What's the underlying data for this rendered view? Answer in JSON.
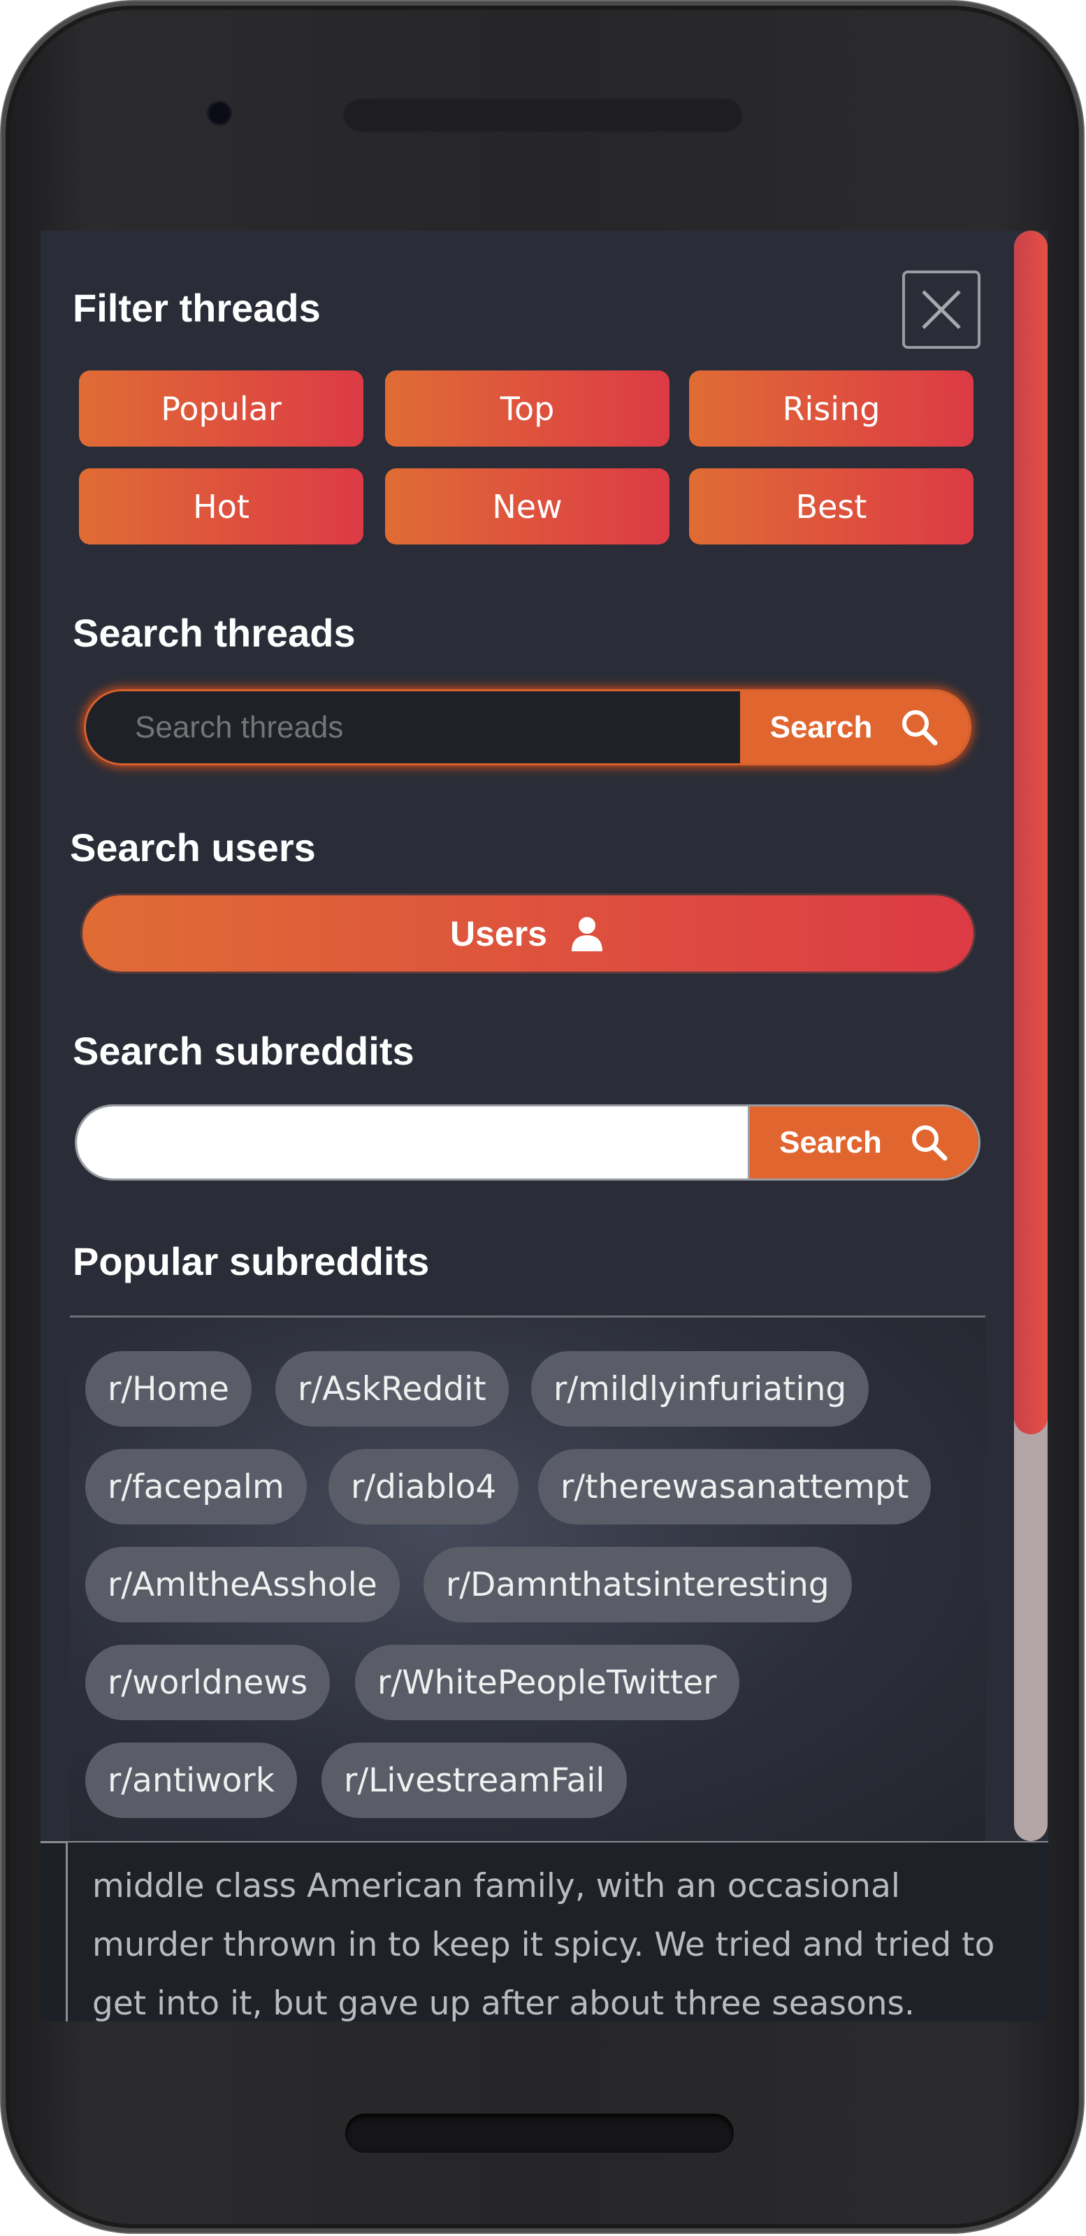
{
  "filter": {
    "title": "Filter threads",
    "buttons": [
      "Popular",
      "Top",
      "Rising",
      "Hot",
      "New",
      "Best"
    ]
  },
  "threads_search": {
    "title": "Search threads",
    "placeholder": "Search threads",
    "button_label": "Search"
  },
  "users_search": {
    "title": "Search users",
    "button_label": "Users"
  },
  "subreddit_search": {
    "title": "Search subreddits",
    "value": "",
    "button_label": "Search"
  },
  "popular": {
    "title": "Popular subreddits",
    "tags": [
      "r/Home",
      "r/AskReddit",
      "r/mildlyinfuriating",
      "r/facepalm",
      "r/diablo4",
      "r/therewasanattempt",
      "r/AmItheAsshole",
      "r/Damnthatsinteresting",
      "r/worldnews",
      "r/WhitePeopleTwitter",
      "r/antiwork",
      "r/LivestreamFail"
    ]
  },
  "background_post": {
    "lines": [
      "middle class American family, with an occasional",
      "murder thrown in to keep it spicy. We tried and tried to",
      "get into it, but gave up after about three seasons."
    ]
  },
  "colors": {
    "accent_start": "#e06c35",
    "accent_end": "#dc3a45",
    "panel": "#2a2d37"
  },
  "icons": {
    "close": "close-icon",
    "search": "search-icon",
    "user": "user-icon"
  }
}
